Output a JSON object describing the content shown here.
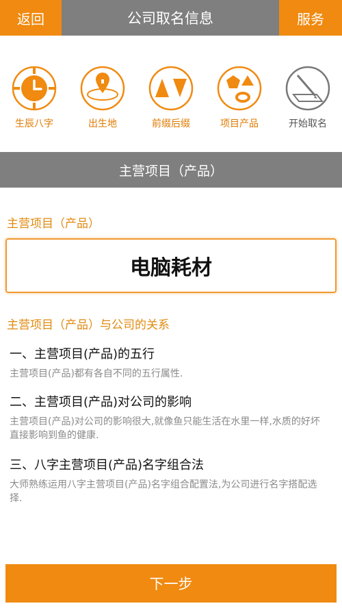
{
  "header": {
    "back_label": "返回",
    "title": "公司取名信息",
    "service_label": "服务"
  },
  "steps": [
    {
      "label": "生辰八字",
      "icon": "clock-icon"
    },
    {
      "label": "出生地",
      "icon": "location-pin-icon"
    },
    {
      "label": "前缀后缀",
      "icon": "triangles-icon"
    },
    {
      "label": "项目产品",
      "icon": "shapes-icon"
    },
    {
      "label": "开始取名",
      "icon": "pen-paper-icon"
    }
  ],
  "section_title": "主营项目（产品）",
  "field": {
    "label": "主营项目（产品）",
    "value": "电脑耗材"
  },
  "relation_title": "主营项目（产品）与公司的关系",
  "items": [
    {
      "title": "一、主营项目(产品)的五行",
      "desc": "主营项目(产品)都有各自不同的五行属性."
    },
    {
      "title": "二、主营项目(产品)对公司的影响",
      "desc": "主营项目(产品)对公司的影响很大,就像鱼只能生活在水里一样,水质的好坏直接影响到鱼的健康."
    },
    {
      "title": "三、八字主营项目(产品)名字组合法",
      "desc": "大师熟练运用八字主营项目(产品)名字组合配置法,为公司进行名字搭配选择."
    }
  ],
  "next_label": "下一步",
  "colors": {
    "accent": "#f08a10",
    "bar": "#7f7f7f",
    "inactive": "#777777"
  }
}
